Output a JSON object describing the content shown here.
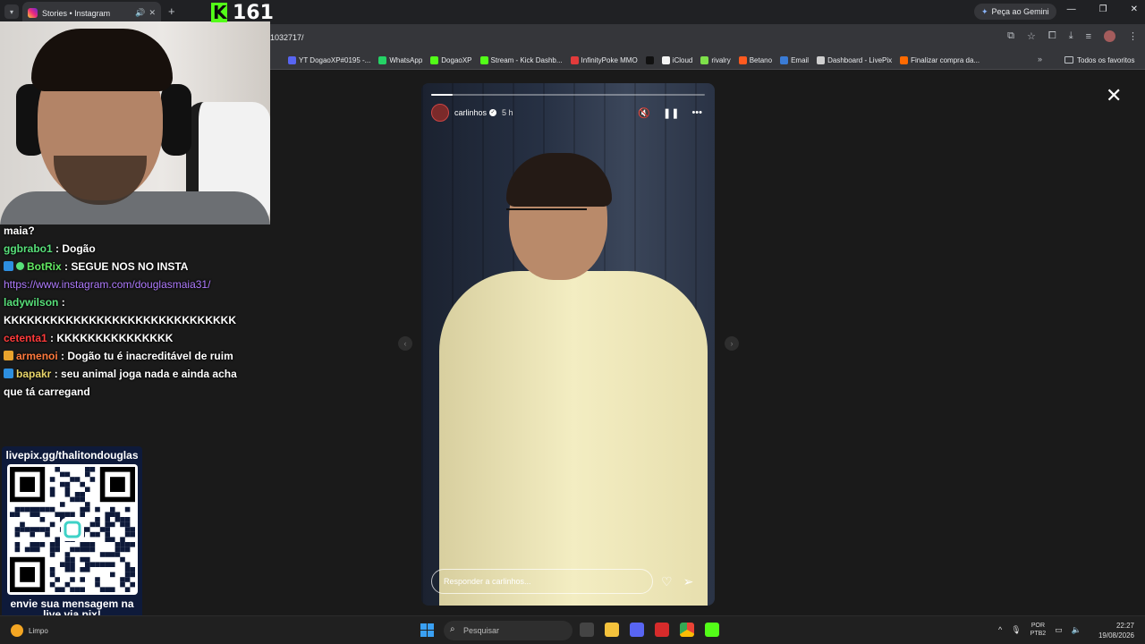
{
  "browser": {
    "tab_title": "Stories • Instagram",
    "url_fragment": "1032717/",
    "gemini_label": "Peça ao Gemini",
    "bookmarks": [
      {
        "label": "YT DogaoXP#0195 -...",
        "color": "#5865f2"
      },
      {
        "label": "WhatsApp",
        "color": "#25d366"
      },
      {
        "label": "DogaoXP",
        "color": "#53fc18"
      },
      {
        "label": "Stream - Kick Dashb...",
        "color": "#53fc18"
      },
      {
        "label": "InfinityPoke MMO",
        "color": "#e23b3b"
      },
      {
        "label": "",
        "color": "#111111",
        "icon": "x-icon"
      },
      {
        "label": "iCloud",
        "color": "#f4f4f4"
      },
      {
        "label": "rivalry",
        "color": "#7ee04a"
      },
      {
        "label": "Betano",
        "color": "#ff5a1f"
      },
      {
        "label": "Email",
        "color": "#3a7bd5"
      },
      {
        "label": "Dashboard - LivePix",
        "color": "#cfcfcf"
      },
      {
        "label": "Finalizar compra da...",
        "color": "#ff6a00"
      }
    ],
    "bookmarks_all": "Todos os favoritos"
  },
  "story": {
    "username": "carlinhos",
    "time": "5 h",
    "progress": 0.08,
    "reply_placeholder": "Responder a carlinhos..."
  },
  "stream": {
    "viewer_count": "161",
    "chat": [
      {
        "user": "",
        "text": "maia?",
        "color": "u-green"
      },
      {
        "user": "ggbrabo1",
        "text": ": Dogão",
        "color": "u-green"
      },
      {
        "user": "BotRix",
        "text": ": SEGUE NOS NO INSTA",
        "color": "u-bot",
        "badges": [
          "blue",
          "check"
        ]
      },
      {
        "user": "",
        "text": "https://www.instagram.com/douglasmaia31/",
        "link": true
      },
      {
        "user": "ladywilson",
        "text": ":",
        "color": "u-green"
      },
      {
        "user": "",
        "text": "KKKKKKKKKKKKKKKKKKKKKKKKKKKKKK"
      },
      {
        "user": "cetenta1",
        "text": ": KKKKKKKKKKKKKKK",
        "color": "u-red"
      },
      {
        "user": "armenoi",
        "text": ": Dogão tu é inacreditável de ruim",
        "color": "u-orange",
        "badges": [
          "crown"
        ]
      },
      {
        "user": "bapakr",
        "text": ": seu animal joga nada e ainda acha",
        "color": "u-yellow",
        "badges": [
          "blue"
        ]
      },
      {
        "user": "",
        "text": "que tá carregand"
      }
    ],
    "qr_top": "livepix.gg/thalitondouglas",
    "qr_bottom": "envie sua mensagem na live via pix!"
  },
  "taskbar": {
    "weather": "Limpo",
    "search_placeholder": "Pesquisar",
    "lang_top": "POR",
    "lang_bottom": "PTB2",
    "time": "22:27",
    "date": "19/08/2026"
  }
}
